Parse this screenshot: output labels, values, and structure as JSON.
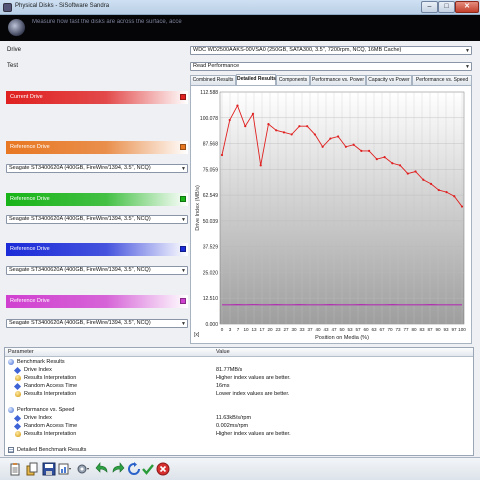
{
  "window": {
    "title": "Physical Disks - SiSoftware Sandra",
    "min": "–",
    "max": "□",
    "close": "✕"
  },
  "banner": {
    "hint": "Measure how fast the disks are across the surface, access time and speed"
  },
  "drive": {
    "label": "Drive",
    "value": "WDC WD2500AAKS-00VSA0 (250GB, SATA300, 3.5\", 7200rpm, NCQ, 16MB Cache)"
  },
  "test": {
    "label": "Test",
    "value": "Read Performance"
  },
  "current_drive": {
    "label": "Current Drive",
    "color": "#e02020"
  },
  "reference_drives": [
    {
      "label": "Reference Drive",
      "color": "#e87722",
      "device": "Seagate ST3400620A (400GB, FireWire/1394, 3.5\", NCQ)"
    },
    {
      "label": "Reference Drive",
      "color": "#18b418",
      "device": "Seagate ST3400620A (400GB, FireWire/1394, 3.5\", NCQ)"
    },
    {
      "label": "Reference Drive",
      "color": "#1a2bd8",
      "device": "Seagate ST3400620A (400GB, FireWire/1394, 3.5\", NCQ)"
    },
    {
      "label": "Reference Drive",
      "color": "#d040d0",
      "device": "Seagate ST3400620A (400GB, FireWire/1394, 3.5\", NCQ)"
    }
  ],
  "tabs": [
    "Combined Results",
    "Detailed Results",
    "Components",
    "Performance vs. Power",
    "Capacity vs Power",
    "Performance vs. Speed"
  ],
  "active_tab": "Detailed Results",
  "chart_data": {
    "type": "line",
    "xlabel": "Position on Media (%)",
    "ylabel": "Drive Index (MB/s)",
    "ylim": [
      0,
      112.588
    ],
    "yticks": [
      "112.588",
      "100.078",
      "87.568",
      "75.059",
      "62.549",
      "50.039",
      "37.529",
      "25.020",
      "12.510",
      "0.000"
    ],
    "xticks": [
      "0",
      "3",
      "7",
      "10",
      "13",
      "17",
      "20",
      "23",
      "27",
      "30",
      "33",
      "37",
      "40",
      "43",
      "47",
      "50",
      "53",
      "57",
      "60",
      "63",
      "67",
      "70",
      "73",
      "77",
      "80",
      "83",
      "87",
      "90",
      "93",
      "97",
      "100"
    ],
    "corner_label": "[x]",
    "grid": true,
    "series": [
      {
        "color": "#e02020",
        "values": [
          82,
          99,
          106,
          96,
          102,
          77,
          97,
          94,
          93,
          92,
          96,
          96,
          92,
          86,
          90,
          91,
          86,
          87,
          84,
          84,
          80,
          81,
          78,
          77,
          73,
          74,
          70,
          68,
          65,
          64,
          62,
          57
        ]
      },
      {
        "color": "#b030b0",
        "values": [
          9.3,
          9.3,
          9.4,
          9.3,
          9.4,
          9.3,
          9.3,
          9.4,
          9.3,
          9.3,
          9.4,
          9.3,
          9.3,
          9.3,
          9.4,
          9.3,
          9.3,
          9.3,
          9.4,
          9.3,
          9.3,
          9.3,
          9.4,
          9.3,
          9.3,
          9.3,
          9.3,
          9.4,
          9.3,
          9.3,
          9.3,
          9.3
        ]
      }
    ]
  },
  "details": {
    "col_parameter": "Parameter",
    "col_value": "Value",
    "rows": [
      {
        "icon": "group",
        "param": "Benchmark Results",
        "value": ""
      },
      {
        "icon": "diamond",
        "param": "Drive Index",
        "value": "81.77MB/s"
      },
      {
        "icon": "bulb",
        "param": "Results Interpretation",
        "value": "Higher index values are better."
      },
      {
        "icon": "diamond",
        "param": "Random Access Time",
        "value": "16ms"
      },
      {
        "icon": "bulb",
        "param": "Results Interpretation",
        "value": "Lower index values are better."
      },
      {
        "icon": "",
        "param": "",
        "value": ""
      },
      {
        "icon": "group",
        "param": "Performance vs. Speed",
        "value": ""
      },
      {
        "icon": "diamond",
        "param": "Drive Index",
        "value": "11.63kB/s/rpm"
      },
      {
        "icon": "diamond",
        "param": "Random Access Time",
        "value": "0.002ms/rpm"
      },
      {
        "icon": "bulb",
        "param": "Results Interpretation",
        "value": "Higher index values are better."
      },
      {
        "icon": "",
        "param": "",
        "value": ""
      },
      {
        "icon": "table",
        "param": "Detailed Benchmark Results",
        "value": ""
      }
    ]
  },
  "toolbar": [
    "report-icon",
    "copy-icon",
    "save-icon",
    "chart-options-icon",
    "options-icon",
    "back-icon",
    "forward-icon",
    "refresh-icon",
    "ok-icon",
    "cancel-icon"
  ]
}
